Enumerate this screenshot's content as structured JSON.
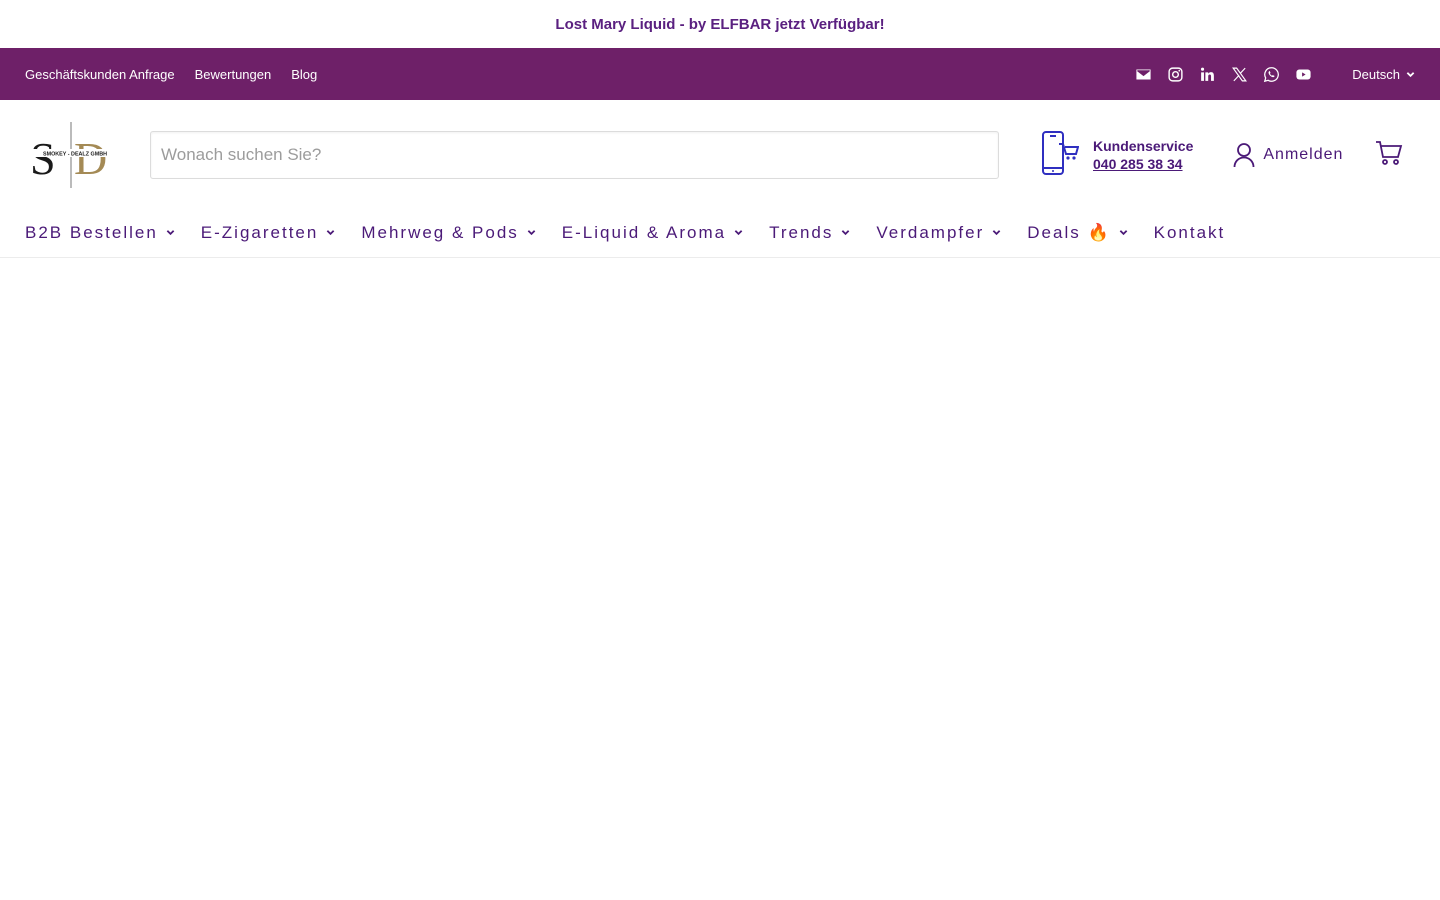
{
  "announcement": {
    "text": "Lost Mary Liquid - by ELFBAR jetzt Verfügbar!"
  },
  "utility": {
    "links": [
      "Geschäftskunden Anfrage",
      "Bewertungen",
      "Blog"
    ],
    "social_icons": [
      "mail-icon",
      "instagram-icon",
      "linkedin-icon",
      "x-icon",
      "whatsapp-icon",
      "youtube-icon"
    ],
    "language": "Deutsch"
  },
  "header": {
    "logo_text": "SMOKEY - DEALZ GMBH",
    "search_placeholder": "Wonach suchen Sie?",
    "service_title": "Kundenservice",
    "service_phone": "040 285 38 34",
    "account_label": "Anmelden"
  },
  "nav": {
    "items": [
      "B2B Bestellen",
      "E-Zigaretten",
      "Mehrweg & Pods",
      "E-Liquid & Aroma",
      "Trends",
      "Verdampfer",
      "Deals 🔥",
      "Kontakt"
    ]
  },
  "colors": {
    "brand_purple": "#6e2068",
    "text_purple": "#4b1a78",
    "logo_gold": "#a48a55"
  }
}
